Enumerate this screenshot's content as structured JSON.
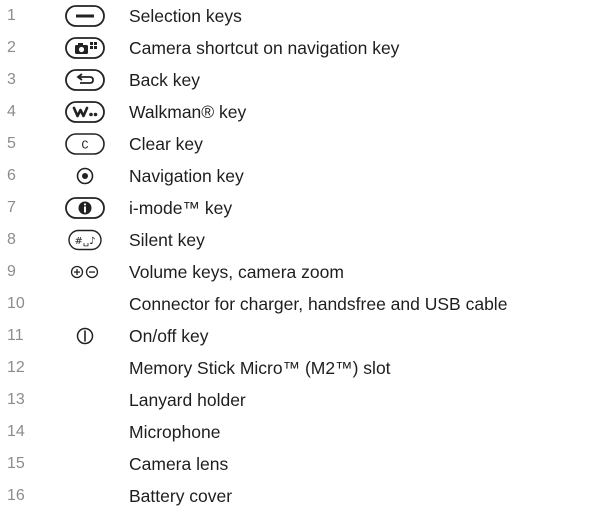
{
  "keys": [
    {
      "number": "1",
      "icon": "selection-key-icon",
      "label": "Selection keys"
    },
    {
      "number": "2",
      "icon": "camera-shortcut-icon",
      "label": "Camera shortcut on navigation key"
    },
    {
      "number": "3",
      "icon": "back-key-icon",
      "label": "Back key"
    },
    {
      "number": "4",
      "icon": "walkman-key-icon",
      "label": "Walkman® key"
    },
    {
      "number": "5",
      "icon": "clear-key-icon",
      "label": "Clear key"
    },
    {
      "number": "6",
      "icon": "navigation-key-icon",
      "label": "Navigation key"
    },
    {
      "number": "7",
      "icon": "i-mode-key-icon",
      "label": "i-mode™ key"
    },
    {
      "number": "8",
      "icon": "silent-key-icon",
      "label": "Silent key"
    },
    {
      "number": "9",
      "icon": "volume-keys-icon",
      "label": "Volume keys, camera zoom"
    },
    {
      "number": "10",
      "icon": "",
      "label": "Connector for charger, handsfree and USB cable"
    },
    {
      "number": "11",
      "icon": "power-key-icon",
      "label": "On/off key"
    },
    {
      "number": "12",
      "icon": "",
      "label": "Memory Stick Micro™ (M2™) slot"
    },
    {
      "number": "13",
      "icon": "",
      "label": "Lanyard holder"
    },
    {
      "number": "14",
      "icon": "",
      "label": "Microphone"
    },
    {
      "number": "15",
      "icon": "",
      "label": "Camera lens"
    },
    {
      "number": "16",
      "icon": "",
      "label": "Battery cover"
    }
  ],
  "icon_glyphs": {
    "clear_key": "C",
    "silent_key": "#␣♪"
  }
}
